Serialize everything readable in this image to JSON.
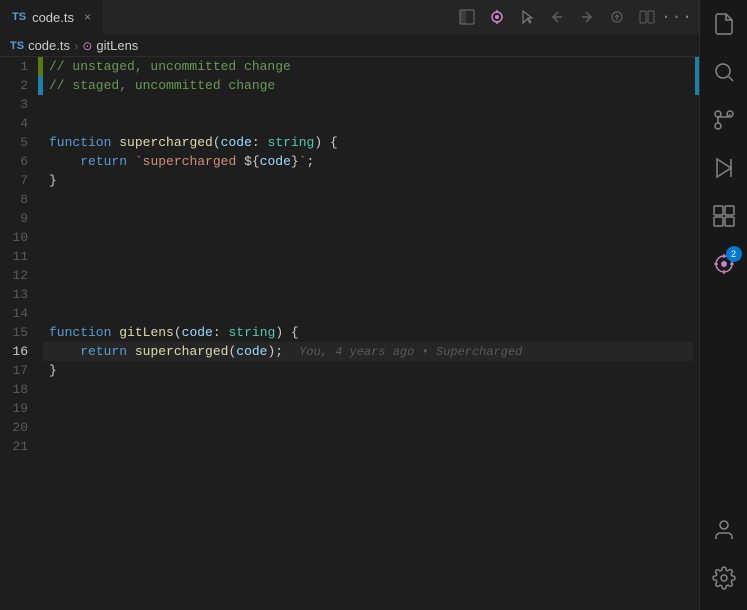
{
  "tab": {
    "lang": "TS",
    "filename": "code.ts",
    "close_label": "×"
  },
  "breadcrumb": {
    "lang": "TS",
    "filename": "code.ts",
    "separator": ">",
    "func_label": "gitLens"
  },
  "toolbar": {
    "icons": [
      "⊞",
      "↺",
      "◇",
      "→",
      "▶",
      "⊟",
      "⋯"
    ]
  },
  "lines": [
    {
      "num": 1,
      "git": "added",
      "code_html": "<span class='comment'>// unstaged, uncommitted change</span>"
    },
    {
      "num": 2,
      "git": "modified",
      "code_html": "<span class='comment'>// staged, uncommitted change</span>"
    },
    {
      "num": 3,
      "git": "",
      "code_html": ""
    },
    {
      "num": 4,
      "git": "",
      "code_html": ""
    },
    {
      "num": 5,
      "git": "",
      "code_html": "<span class='kw'>function</span> <span class='fn'>supercharged</span><span class='punct'>(</span><span class='param'>code</span><span class='punct'>:</span> <span class='type'>string</span><span class='punct'>) {</span>"
    },
    {
      "num": 6,
      "git": "",
      "code_html": "    <span class='kw'>return</span> <span class='tmpl-str'>`supercharged </span><span class='punct'>${</span><span class='tmpl-expr'>code</span><span class='punct'>}</span><span class='tmpl-str'>`</span><span class='punct'>;</span>"
    },
    {
      "num": 7,
      "git": "",
      "code_html": "<span class='punct'>}</span>"
    },
    {
      "num": 8,
      "git": "",
      "code_html": ""
    },
    {
      "num": 9,
      "git": "",
      "code_html": ""
    },
    {
      "num": 10,
      "git": "",
      "code_html": ""
    },
    {
      "num": 11,
      "git": "",
      "code_html": ""
    },
    {
      "num": 12,
      "git": "",
      "code_html": ""
    },
    {
      "num": 13,
      "git": "",
      "code_html": ""
    },
    {
      "num": 14,
      "git": "",
      "code_html": ""
    },
    {
      "num": 15,
      "git": "",
      "code_html": "<span class='kw'>function</span> <span class='fn'>gitLens</span><span class='punct'>(</span><span class='param'>code</span><span class='punct'>:</span> <span class='type'>string</span><span class='punct'>) {</span>"
    },
    {
      "num": 16,
      "git": "",
      "code_html": "    <span class='kw'>return</span> <span class='fn'>supercharged</span><span class='punct'>(</span><span class='param'>code</span><span class='punct'>);</span>",
      "blame": "You, 4 years ago • Supercharged",
      "active": true
    },
    {
      "num": 17,
      "git": "",
      "code_html": "<span class='punct'>}</span>"
    },
    {
      "num": 18,
      "git": "",
      "code_html": ""
    },
    {
      "num": 19,
      "git": "",
      "code_html": ""
    },
    {
      "num": 20,
      "git": "",
      "code_html": ""
    },
    {
      "num": 21,
      "git": "",
      "code_html": ""
    }
  ],
  "activity_bar": {
    "top_icons": [
      "files",
      "search",
      "git",
      "run",
      "extensions",
      "gitlens"
    ],
    "bottom_icons": [
      "account",
      "settings"
    ],
    "gitlens_badge": "2"
  }
}
